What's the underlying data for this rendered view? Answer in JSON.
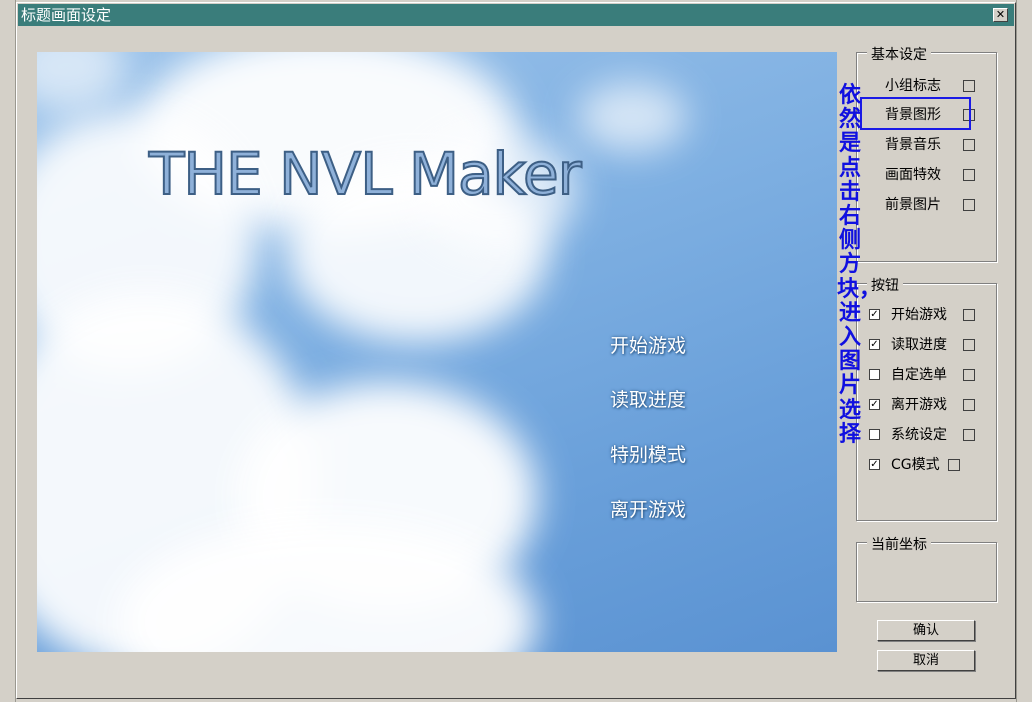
{
  "window": {
    "title": "标题画面设定",
    "close_glyph": "✕"
  },
  "preview": {
    "logo_text": "THE NVL Maker",
    "menu": [
      "开始游戏",
      "读取进度",
      "特别模式",
      "离开游戏"
    ]
  },
  "basic": {
    "legend": "基本设定",
    "items": [
      "小组标志",
      "背景图形",
      "背景音乐",
      "画面特效",
      "前景图片"
    ]
  },
  "buttons_group": {
    "legend": "按钮",
    "items": [
      {
        "label": "开始游戏",
        "checked": true
      },
      {
        "label": "读取进度",
        "checked": true
      },
      {
        "label": "自定选单",
        "checked": false
      },
      {
        "label": "离开游戏",
        "checked": true
      },
      {
        "label": "系统设定",
        "checked": false
      },
      {
        "label": "CG模式",
        "checked": true
      }
    ]
  },
  "coords": {
    "legend": "当前坐标"
  },
  "actions": {
    "ok": "确认",
    "cancel": "取消"
  },
  "annotation": {
    "text": "依然是点击右侧方块，进入图片选择",
    "color": "#1010e0"
  },
  "colors": {
    "titlebar": "#3a7d7b",
    "dialog": "#d4d0c8"
  }
}
